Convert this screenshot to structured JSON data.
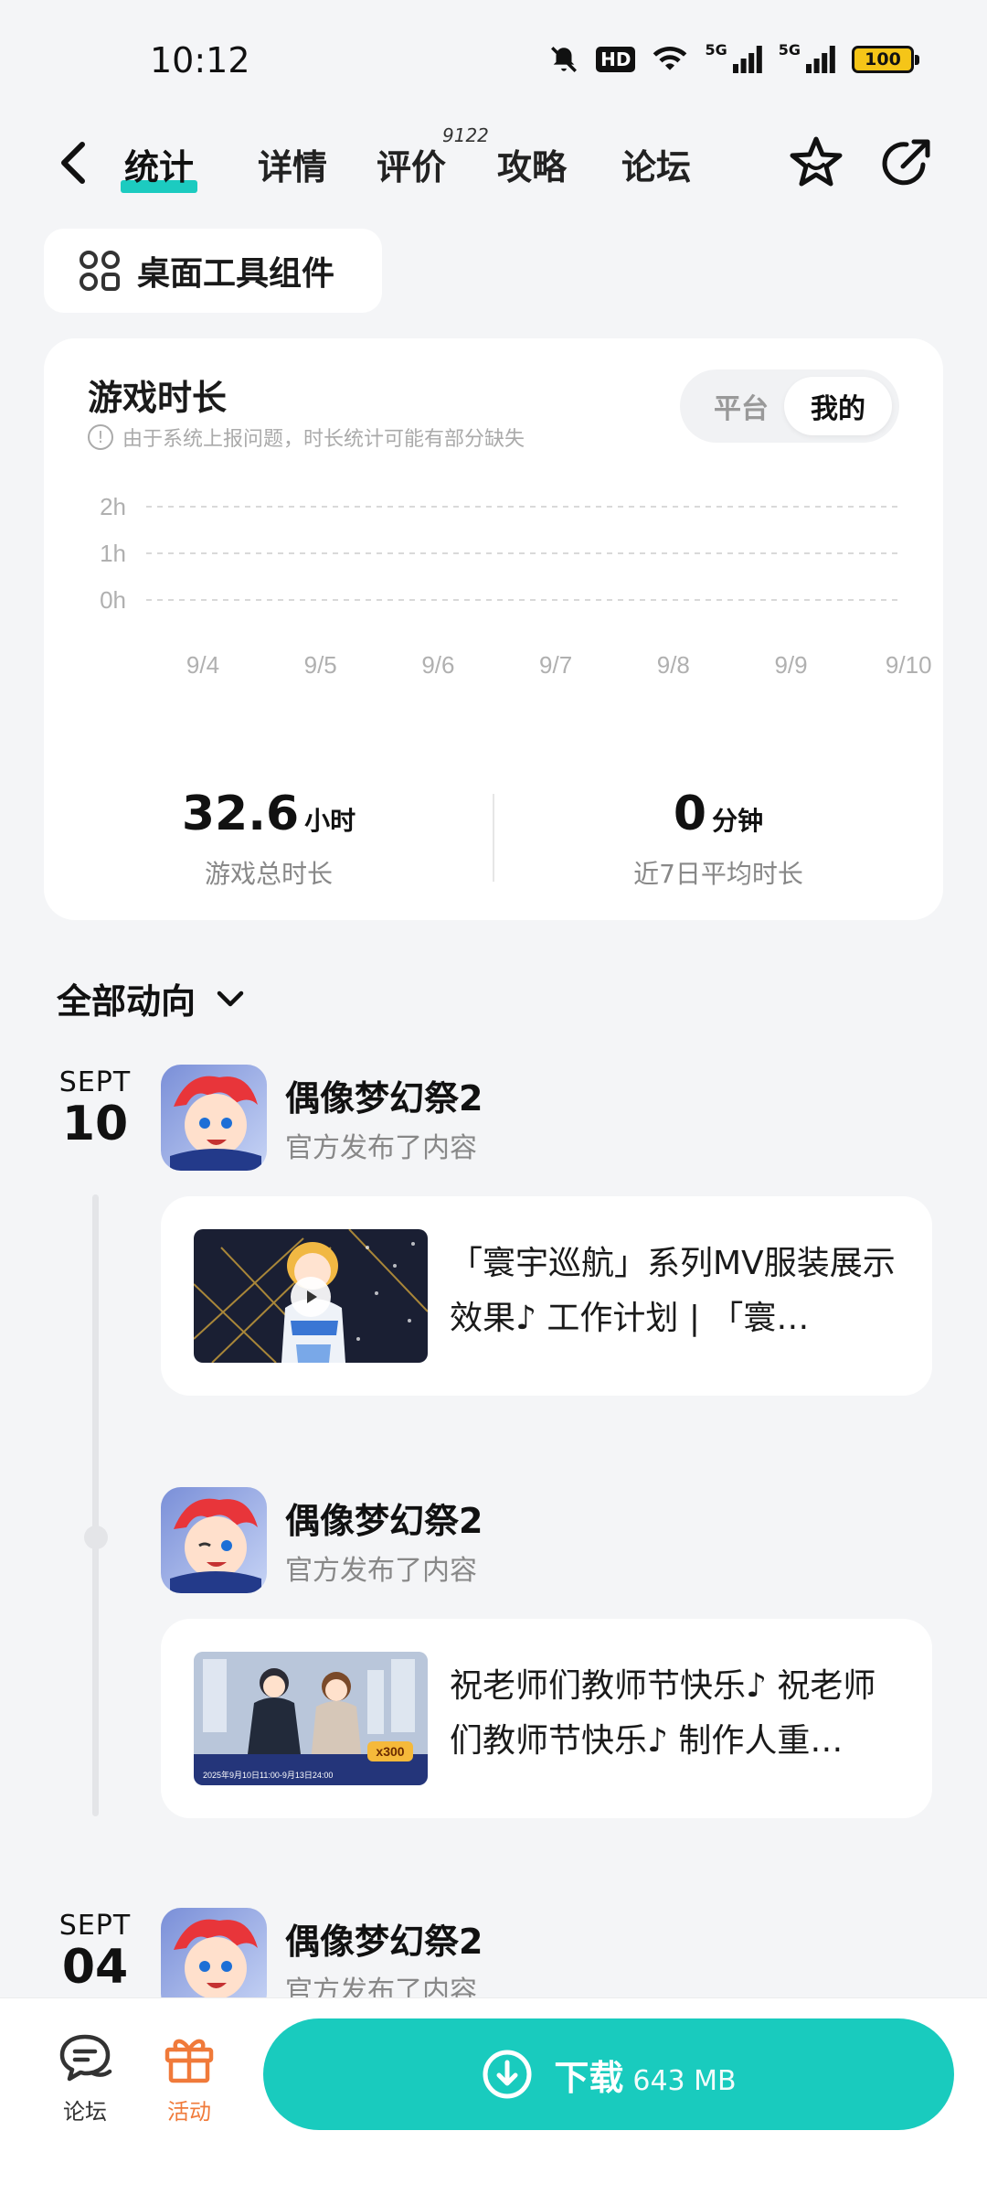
{
  "status": {
    "time": "10:12",
    "hd": "HD",
    "net1": "5G",
    "net2": "5G",
    "battery": "100"
  },
  "nav": {
    "tabs": [
      {
        "label": "统计"
      },
      {
        "label": "详情"
      },
      {
        "label": "评价"
      },
      {
        "label": "攻略"
      },
      {
        "label": "论坛"
      }
    ],
    "active_tab": "统计",
    "review_count": "9122"
  },
  "widget": {
    "label": "桌面工具组件"
  },
  "stats": {
    "title": "游戏时长",
    "notice": "由于系统上报问题，时长统计可能有部分缺失",
    "toggle": [
      "平台",
      "我的"
    ],
    "toggle_selected": "我的",
    "total_value": "32.6",
    "total_unit": "小时",
    "total_label": "游戏总时长",
    "avg_value": "0",
    "avg_unit": "分钟",
    "avg_label": "近7日平均时长"
  },
  "chart_data": {
    "type": "bar",
    "categories": [
      "9/4",
      "9/5",
      "9/6",
      "9/7",
      "9/8",
      "9/9",
      "9/10"
    ],
    "values": [
      0,
      0,
      0,
      0,
      0,
      0,
      0
    ],
    "ylabel": "",
    "y_ticks": [
      "2h",
      "1h",
      "0h"
    ],
    "ylim": [
      0,
      2
    ],
    "grid": true
  },
  "feed": {
    "filter_label": "全部动向",
    "groups": [
      {
        "month": "SEPT",
        "day": "10",
        "posts": [
          {
            "name": "偶像梦幻祭2",
            "subtitle": "官方发布了内容",
            "text": "「寰宇巡航」系列MV服装展示效果♪ 工作计划 | 「寰…",
            "thumb_type": "video"
          },
          {
            "name": "偶像梦幻祭2",
            "subtitle": "官方发布了内容",
            "text": "祝老师们教师节快乐♪ 祝老师们教师节快乐♪ 制作人重…",
            "thumb_type": "image",
            "thumb_caption": "2025年9月10日11:00-9月13日24:00",
            "thumb_badge": "x300"
          }
        ]
      },
      {
        "month": "SEPT",
        "day": "04",
        "posts": [
          {
            "name": "偶像梦幻祭2",
            "subtitle": "官方发布了内容"
          }
        ]
      }
    ]
  },
  "bottom": {
    "forum_label": "论坛",
    "events_label": "活动",
    "download_label": "下载",
    "download_size": "643 MB"
  },
  "colors": {
    "accent": "#19cbbe",
    "events": "#f07a3a"
  }
}
